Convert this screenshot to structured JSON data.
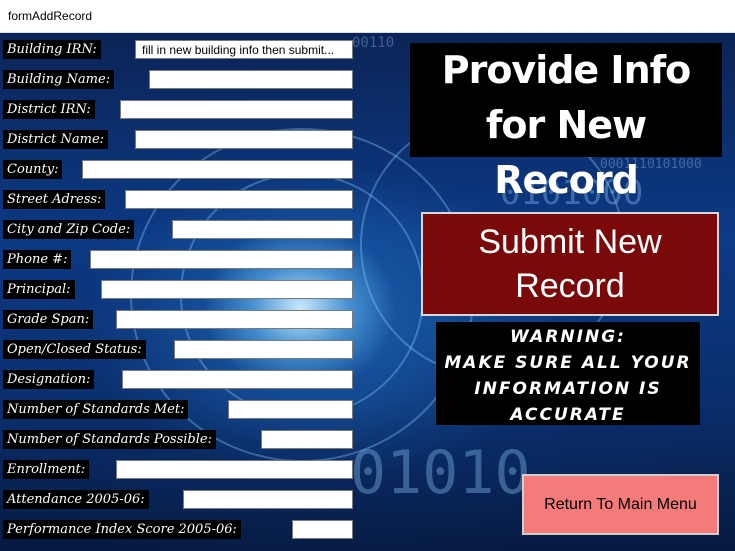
{
  "window": {
    "title": "formAddRecord"
  },
  "fields": [
    {
      "label": "Building IRN:",
      "value": "fill in new building info then submit..."
    },
    {
      "label": "Building Name:",
      "value": ""
    },
    {
      "label": "District IRN:",
      "value": ""
    },
    {
      "label": "District Name:",
      "value": ""
    },
    {
      "label": "County:",
      "value": ""
    },
    {
      "label": "Street Adress:",
      "value": ""
    },
    {
      "label": " City and Zip Code:",
      "value": ""
    },
    {
      "label": "Phone #:",
      "value": ""
    },
    {
      "label": "Principal:",
      "value": ""
    },
    {
      "label": "Grade Span:",
      "value": ""
    },
    {
      "label": "Open/Closed Status:",
      "value": ""
    },
    {
      "label": "Designation:",
      "value": ""
    },
    {
      "label": "Number of Standards Met:",
      "value": ""
    },
    {
      "label": "Number of Standards Possible:",
      "value": ""
    },
    {
      "label": "Enrollment:",
      "value": ""
    },
    {
      "label": "Attendance 2005-06:",
      "value": ""
    },
    {
      "label": "Performance Index Score 2005-06:",
      "value": ""
    }
  ],
  "headline": {
    "line1": "Provide Info",
    "line2": "for New Record"
  },
  "submit_button": {
    "line1": "Submit New",
    "line2": "Record"
  },
  "warning": {
    "line1": "WARNING:",
    "line2": "MAKE SURE ALL YOUR",
    "line3": "INFORMATION IS",
    "line4": "ACCURATE"
  },
  "return_button": {
    "label": "Return To Main Menu"
  },
  "colors": {
    "submit": "#7a0a0a",
    "return": "#f57a7a",
    "label_bg": "#000000"
  }
}
